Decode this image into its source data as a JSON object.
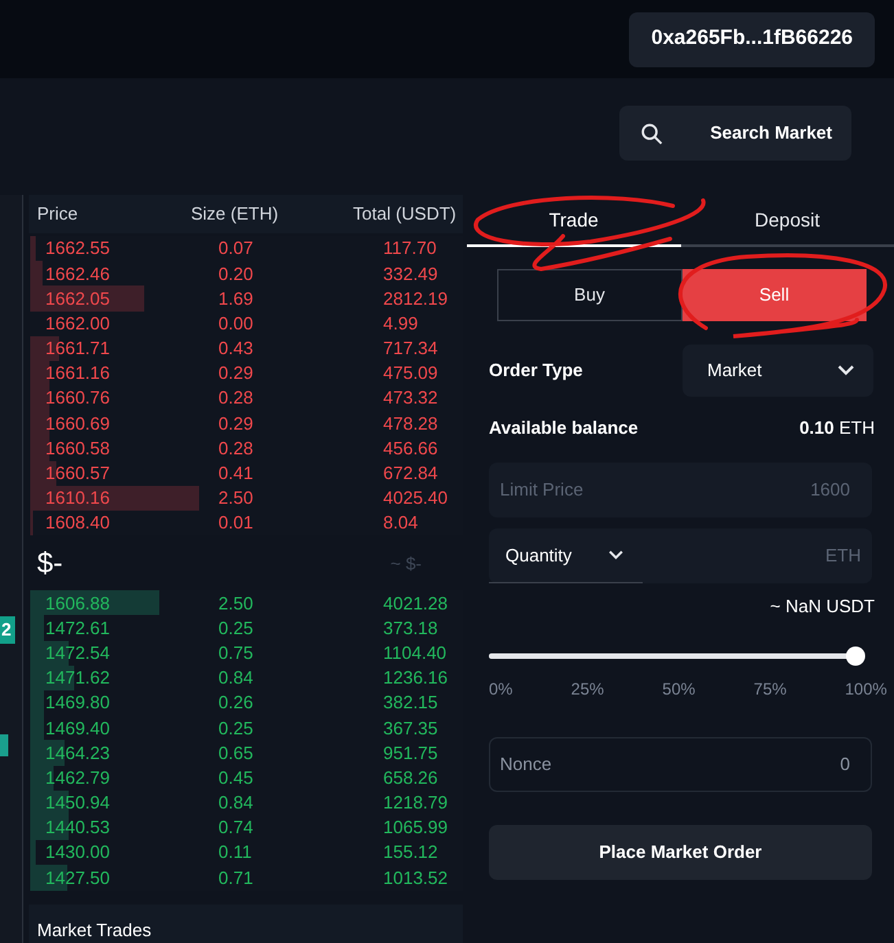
{
  "header": {
    "wallet_address": "0xa265Fb...1fB66226"
  },
  "search": {
    "label": "Search Market"
  },
  "left_panel": {
    "badge": "2"
  },
  "order_book": {
    "columns": [
      "Price",
      "Size (ETH)",
      "Total (USDT)"
    ],
    "asks": [
      {
        "price": "1662.55",
        "size": "0.07",
        "total": "117.70",
        "level": 0.013
      },
      {
        "price": "1662.46",
        "size": "0.20",
        "total": "332.49",
        "level": 0.029
      },
      {
        "price": "1662.05",
        "size": "1.69",
        "total": "2812.19",
        "level": 0.264
      },
      {
        "price": "1662.00",
        "size": "0.00",
        "total": "4.99",
        "level": 0
      },
      {
        "price": "1661.71",
        "size": "0.43",
        "total": "717.34",
        "level": 0.067
      },
      {
        "price": "1661.16",
        "size": "0.29",
        "total": "475.09",
        "level": 0.045
      },
      {
        "price": "1660.76",
        "size": "0.28",
        "total": "473.32",
        "level": 0.045
      },
      {
        "price": "1660.69",
        "size": "0.29",
        "total": "478.28",
        "level": 0.045
      },
      {
        "price": "1660.58",
        "size": "0.28",
        "total": "456.66",
        "level": 0.045
      },
      {
        "price": "1660.57",
        "size": "0.41",
        "total": "672.84",
        "level": 0.06
      },
      {
        "price": "1610.16",
        "size": "2.50",
        "total": "4025.40",
        "level": 0.389
      },
      {
        "price": "1608.40",
        "size": "0.01",
        "total": "8.04",
        "level": 0.006
      }
    ],
    "mid_price": "$-",
    "mid_approx": "~ $-",
    "bids": [
      {
        "price": "1606.88",
        "size": "2.50",
        "total": "4021.28",
        "level": 0.299
      },
      {
        "price": "1472.61",
        "size": "0.25",
        "total": "373.18",
        "level": 0.032
      },
      {
        "price": "1472.54",
        "size": "0.75",
        "total": "1104.40",
        "level": 0.089
      },
      {
        "price": "1471.62",
        "size": "0.84",
        "total": "1236.16",
        "level": 0.102
      },
      {
        "price": "1469.80",
        "size": "0.26",
        "total": "382.15",
        "level": 0.032
      },
      {
        "price": "1469.40",
        "size": "0.25",
        "total": "367.35",
        "level": 0.032
      },
      {
        "price": "1464.23",
        "size": "0.65",
        "total": "951.75",
        "level": 0.08
      },
      {
        "price": "1462.79",
        "size": "0.45",
        "total": "658.26",
        "level": 0.054
      },
      {
        "price": "1450.94",
        "size": "0.84",
        "total": "1218.79",
        "level": 0.089
      },
      {
        "price": "1440.53",
        "size": "0.74",
        "total": "1065.99",
        "level": 0.089
      },
      {
        "price": "1430.00",
        "size": "0.11",
        "total": "155.12",
        "level": 0.013
      },
      {
        "price": "1427.50",
        "size": "0.71",
        "total": "1013.52",
        "level": 0.086
      }
    ]
  },
  "market_trades": {
    "title": "Market Trades"
  },
  "tabs": [
    {
      "label": "Trade",
      "selected": true
    },
    {
      "label": "Deposit",
      "selected": false
    }
  ],
  "sides": [
    {
      "label": "Buy",
      "selected": false
    },
    {
      "label": "Sell",
      "selected": true
    }
  ],
  "order_type": {
    "label": "Order Type",
    "value": "Market"
  },
  "balance": {
    "label": "Available balance",
    "amount": "0.10",
    "unit": "ETH"
  },
  "limit_price": {
    "label": "Limit Price",
    "placeholder": "1600"
  },
  "quantity": {
    "label": "Quantity",
    "unit": "ETH",
    "approx": "~ NaN USDT"
  },
  "slider": {
    "level": 1,
    "ticks": [
      "0%",
      "25%",
      "50%",
      "75%",
      "100%"
    ]
  },
  "nonce": {
    "placeholder": "Nonce",
    "value": "0"
  },
  "submit": {
    "label": "Place Market Order"
  },
  "annotations": [
    {
      "kind": "ellipse"
    },
    {
      "kind": "ellipse"
    }
  ]
}
